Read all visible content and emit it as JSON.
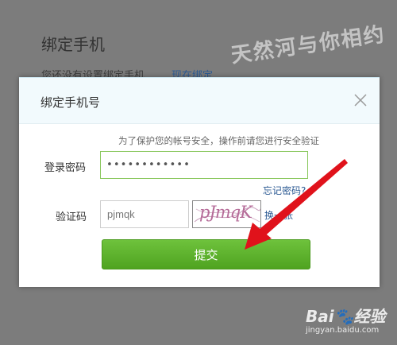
{
  "background": {
    "title": "绑定手机",
    "notice": "您还没有设置绑定手机",
    "bind_now": "现在绑定"
  },
  "watermark": {
    "text": "天然河与你相约",
    "baidu_logo": "Bai🐾经验",
    "baidu_url": "jingyan.baidu.com"
  },
  "modal": {
    "title": "绑定手机号",
    "hint": "为了保护您的帐号安全，操作前请您进行安全验证",
    "password_label": "登录密码",
    "password_value": "••••••••••••",
    "forgot_password": "忘记密码?",
    "code_label": "验证码",
    "code_value": "pjmqk",
    "captcha_text": "pJmqK",
    "refresh": "换一张",
    "submit": "提交"
  },
  "colors": {
    "accent": "#5cb22b",
    "link": "#2c5a93",
    "annotation_red": "#e0121b"
  }
}
